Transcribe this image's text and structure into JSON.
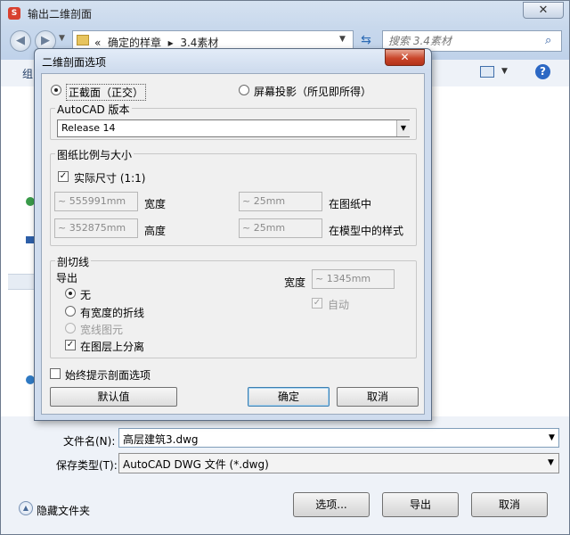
{
  "window": {
    "title": "输出二维剖面",
    "close_glyph": "✕"
  },
  "navigation": {
    "back_glyph": "◀",
    "forward_glyph": "▶",
    "breadcrumb_prefix": "«",
    "breadcrumb": [
      "确定的样章",
      "3.4素材"
    ],
    "breadcrumb_separator": "▸",
    "refresh_glyph": "⇆",
    "search_placeholder": "搜索 3.4素材",
    "search_glyph": "⌕"
  },
  "toolbar": {
    "organize_label": "组",
    "help_glyph": "?"
  },
  "file_fields": {
    "filename_label": "文件名(N):",
    "filename_value": "高层建筑3.dwg",
    "filetype_label": "保存类型(T):",
    "filetype_value": "AutoCAD DWG 文件 (*.dwg)"
  },
  "footer": {
    "hide_folders_label": "隐藏文件夹",
    "options_label": "选项...",
    "export_label": "导出",
    "cancel_label": "取消"
  },
  "dialog": {
    "title": "二维剖面选项",
    "close_glyph": "✕",
    "projection": {
      "orthographic_label": "正截面（正交）",
      "orthographic_selected": true,
      "screen_label": "屏幕投影（所见即所得）",
      "screen_selected": false
    },
    "version_group": {
      "title": "AutoCAD 版本",
      "value": "Release 14"
    },
    "scale_group": {
      "title": "图纸比例与大小",
      "actual_size_label": "实际尺寸 (1:1)",
      "actual_size_checked": true,
      "width_value": "~ 555991mm",
      "width_label": "宽度",
      "height_value": "~ 352875mm",
      "height_label": "高度",
      "paper_value": "~ 25mm",
      "paper_label": "在图纸中",
      "model_value": "~ 25mm",
      "model_label": "在模型中的样式"
    },
    "section_line_group": {
      "title": "剖切线",
      "export_label": "导出",
      "options": [
        {
          "label": "无",
          "selected": true,
          "disabled": false
        },
        {
          "label": "有宽度的折线",
          "selected": false,
          "disabled": false
        },
        {
          "label": "宽线图元",
          "selected": false,
          "disabled": true
        }
      ],
      "separate_layers_label": "在图层上分离",
      "separate_layers_checked": true,
      "width_label": "宽度",
      "width_value": "~ 1345mm",
      "auto_label": "自动",
      "auto_checked": true
    },
    "always_prompt_label": "始终提示剖面选项",
    "always_prompt_checked": false,
    "defaults_label": "默认值",
    "ok_label": "确定",
    "cancel_label": "取消"
  }
}
